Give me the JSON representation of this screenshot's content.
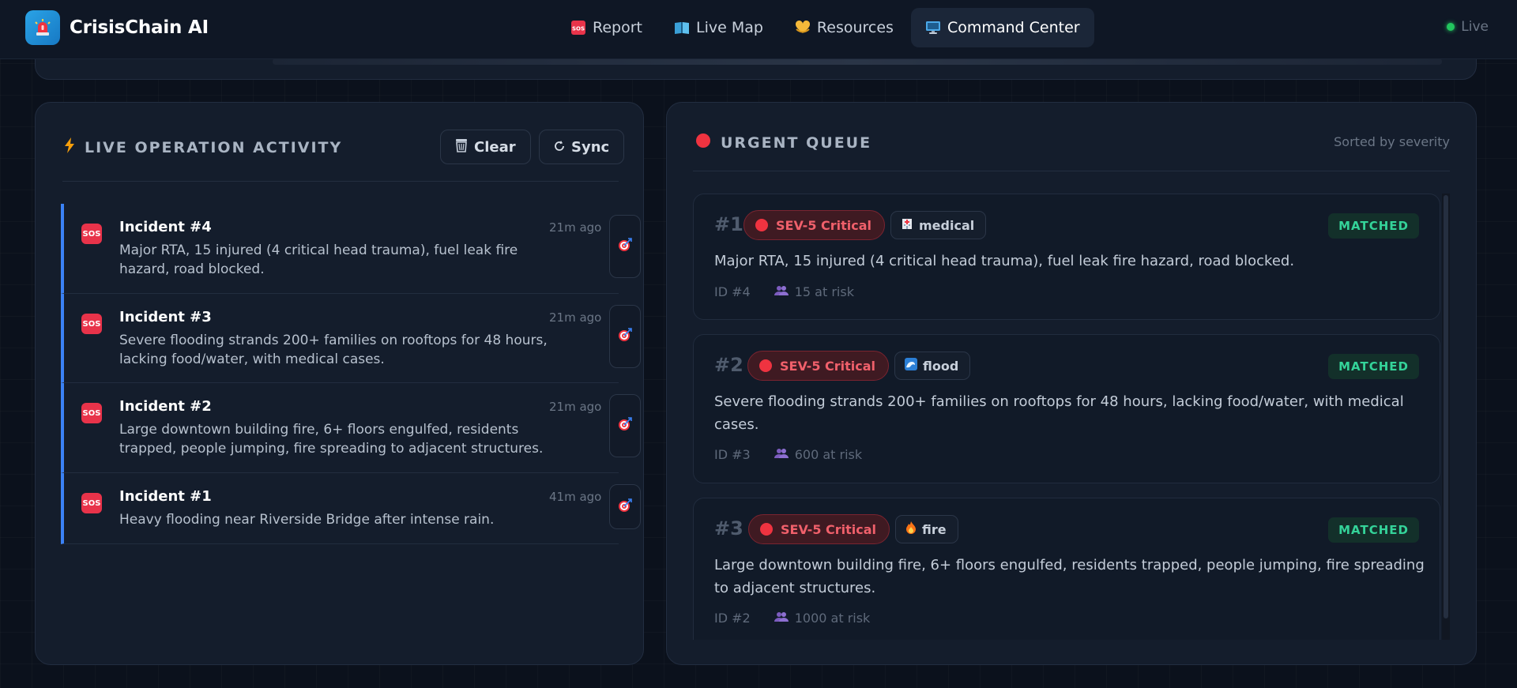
{
  "app": {
    "name": "CrisisChain AI",
    "live_label": "Live"
  },
  "nav": [
    {
      "label": "Report",
      "icon": "sos-icon"
    },
    {
      "label": "Live Map",
      "icon": "map-book-icon"
    },
    {
      "label": "Resources",
      "icon": "heart-hands-icon"
    },
    {
      "label": "Command Center",
      "icon": "monitor-icon",
      "active": true
    }
  ],
  "activity": {
    "title": "LIVE OPERATION ACTIVITY",
    "clear_label": "Clear",
    "sync_label": "Sync",
    "items": [
      {
        "badge": "SOS",
        "title": "Incident #4",
        "time": "21m ago",
        "text": "Major RTA, 15 injured (4 critical head trauma), fuel leak fire hazard, road blocked."
      },
      {
        "badge": "SOS",
        "title": "Incident #3",
        "time": "21m ago",
        "text": "Severe flooding strands 200+ families on rooftops for 48 hours, lacking food/water, with medical cases."
      },
      {
        "badge": "SOS",
        "title": "Incident #2",
        "time": "21m ago",
        "text": "Large downtown building fire, 6+ floors engulfed, residents trapped, people jumping, fire spreading to adjacent structures."
      },
      {
        "badge": "SOS",
        "title": "Incident #1",
        "time": "41m ago",
        "text": "Heavy flooding near Riverside Bridge after intense rain."
      }
    ]
  },
  "queue": {
    "title": "URGENT QUEUE",
    "sorted_label": "Sorted by severity",
    "items": [
      {
        "rank": "#1",
        "severity": "SEV-5 Critical",
        "category": "medical",
        "category_icon": "hospital-icon",
        "status": "MATCHED",
        "text": "Major RTA, 15 injured (4 critical head trauma), fuel leak fire hazard, road blocked.",
        "id": "ID #4",
        "at_risk": "15 at risk"
      },
      {
        "rank": "#2",
        "severity": "SEV-5 Critical",
        "category": "flood",
        "category_icon": "wave-icon",
        "status": "MATCHED",
        "text": "Severe flooding strands 200+ families on rooftops for 48 hours, lacking food/water, with medical cases.",
        "id": "ID #3",
        "at_risk": "600 at risk"
      },
      {
        "rank": "#3",
        "severity": "SEV-5 Critical",
        "category": "fire",
        "category_icon": "fire-icon",
        "status": "MATCHED",
        "text": "Large downtown building fire, 6+ floors engulfed, residents trapped, people jumping, fire spreading to adjacent structures.",
        "id": "ID #2",
        "at_risk": "1000 at risk"
      }
    ]
  },
  "colors": {
    "accent_blue": "#3b82f6",
    "critical_red": "#ef3340",
    "matched_green": "#34d399",
    "live_green": "#22c55e"
  }
}
